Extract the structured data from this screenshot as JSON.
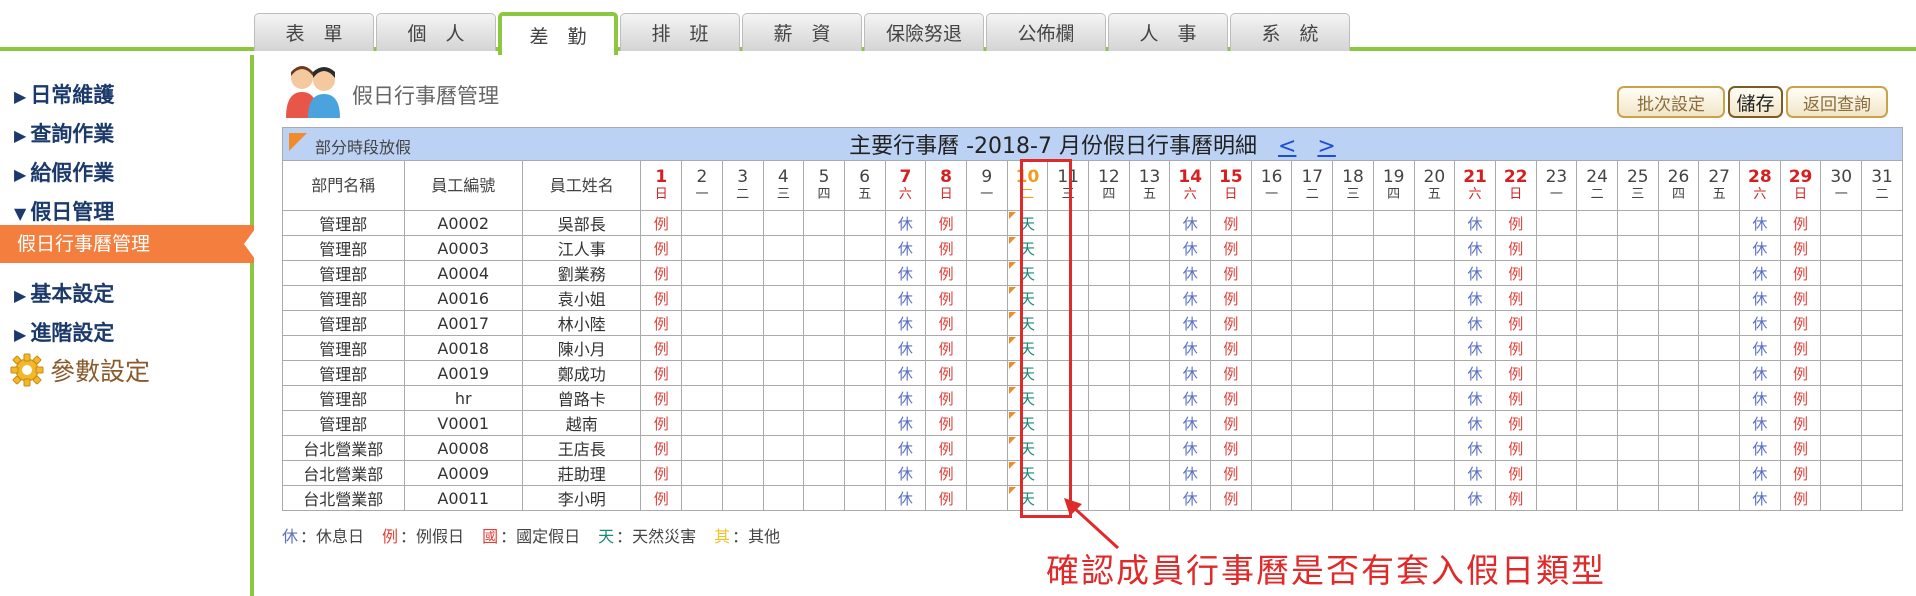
{
  "tabs": [
    "表　單",
    "個　人",
    "差　勤",
    "排　班",
    "薪　資",
    "保險努退",
    "公佈欄",
    "人　事",
    "系　統"
  ],
  "active_tab": 2,
  "sidebar": {
    "items": [
      {
        "label": "日常維護",
        "arrow": "▶"
      },
      {
        "label": "查詢作業",
        "arrow": "▶"
      },
      {
        "label": "給假作業",
        "arrow": "▶"
      },
      {
        "label": "假日管理",
        "arrow": "▼"
      }
    ],
    "active": "假日行事曆管理",
    "items_after": [
      {
        "label": "基本設定",
        "arrow": "▶"
      },
      {
        "label": "進階設定",
        "arrow": "▶"
      }
    ],
    "param": "參數設定"
  },
  "header": {
    "title": "假日行事曆管理",
    "btn_batch": "批次設定",
    "btn_save": "儲存",
    "btn_back": "返回查詢"
  },
  "table": {
    "caption_left": "部分時段放假",
    "caption_main": "主要行事曆 -2018-7 月份假日行事曆明細",
    "prev": "<",
    "next": ">",
    "col_dept": "部門名稱",
    "col_id": "員工編號",
    "col_name": "員工姓名",
    "weekdays": [
      "日",
      "一",
      "二",
      "三",
      "四",
      "五",
      "六"
    ],
    "first_weekday": 0,
    "days": 31,
    "highlight_day": 10,
    "rows": [
      {
        "dept": "管理部",
        "id": "A0002",
        "name": "吳部長"
      },
      {
        "dept": "管理部",
        "id": "A0003",
        "name": "江人事"
      },
      {
        "dept": "管理部",
        "id": "A0004",
        "name": "劉業務"
      },
      {
        "dept": "管理部",
        "id": "A0016",
        "name": "袁小姐"
      },
      {
        "dept": "管理部",
        "id": "A0017",
        "name": "林小陸"
      },
      {
        "dept": "管理部",
        "id": "A0018",
        "name": "陳小月"
      },
      {
        "dept": "管理部",
        "id": "A0019",
        "name": "鄭成功"
      },
      {
        "dept": "管理部",
        "id": "hr",
        "name": "曾路卡"
      },
      {
        "dept": "管理部",
        "id": "V0001",
        "name": "越南"
      },
      {
        "dept": "台北營業部",
        "id": "A0008",
        "name": "王店長"
      },
      {
        "dept": "台北營業部",
        "id": "A0009",
        "name": "莊助理"
      },
      {
        "dept": "台北營業部",
        "id": "A0011",
        "name": "李小明"
      }
    ],
    "marks": {
      "1": "例",
      "7": "休",
      "8": "例",
      "10": "天",
      "14": "休",
      "15": "例",
      "21": "休",
      "22": "例",
      "28": "休",
      "29": "例"
    }
  },
  "legend": [
    {
      "key": "休",
      "label": "：休息日",
      "color": "#5a6fc4"
    },
    {
      "key": "例",
      "label": "：例假日",
      "color": "#e0413a"
    },
    {
      "key": "國",
      "label": "：國定假日",
      "color": "#e0413a"
    },
    {
      "key": "天",
      "label": "：天然災害",
      "color": "#1a8a7a"
    },
    {
      "key": "其",
      "label": "：其他",
      "color": "#f2c12e"
    }
  ],
  "annotation": "確認成員行事曆是否有套入假日類型"
}
